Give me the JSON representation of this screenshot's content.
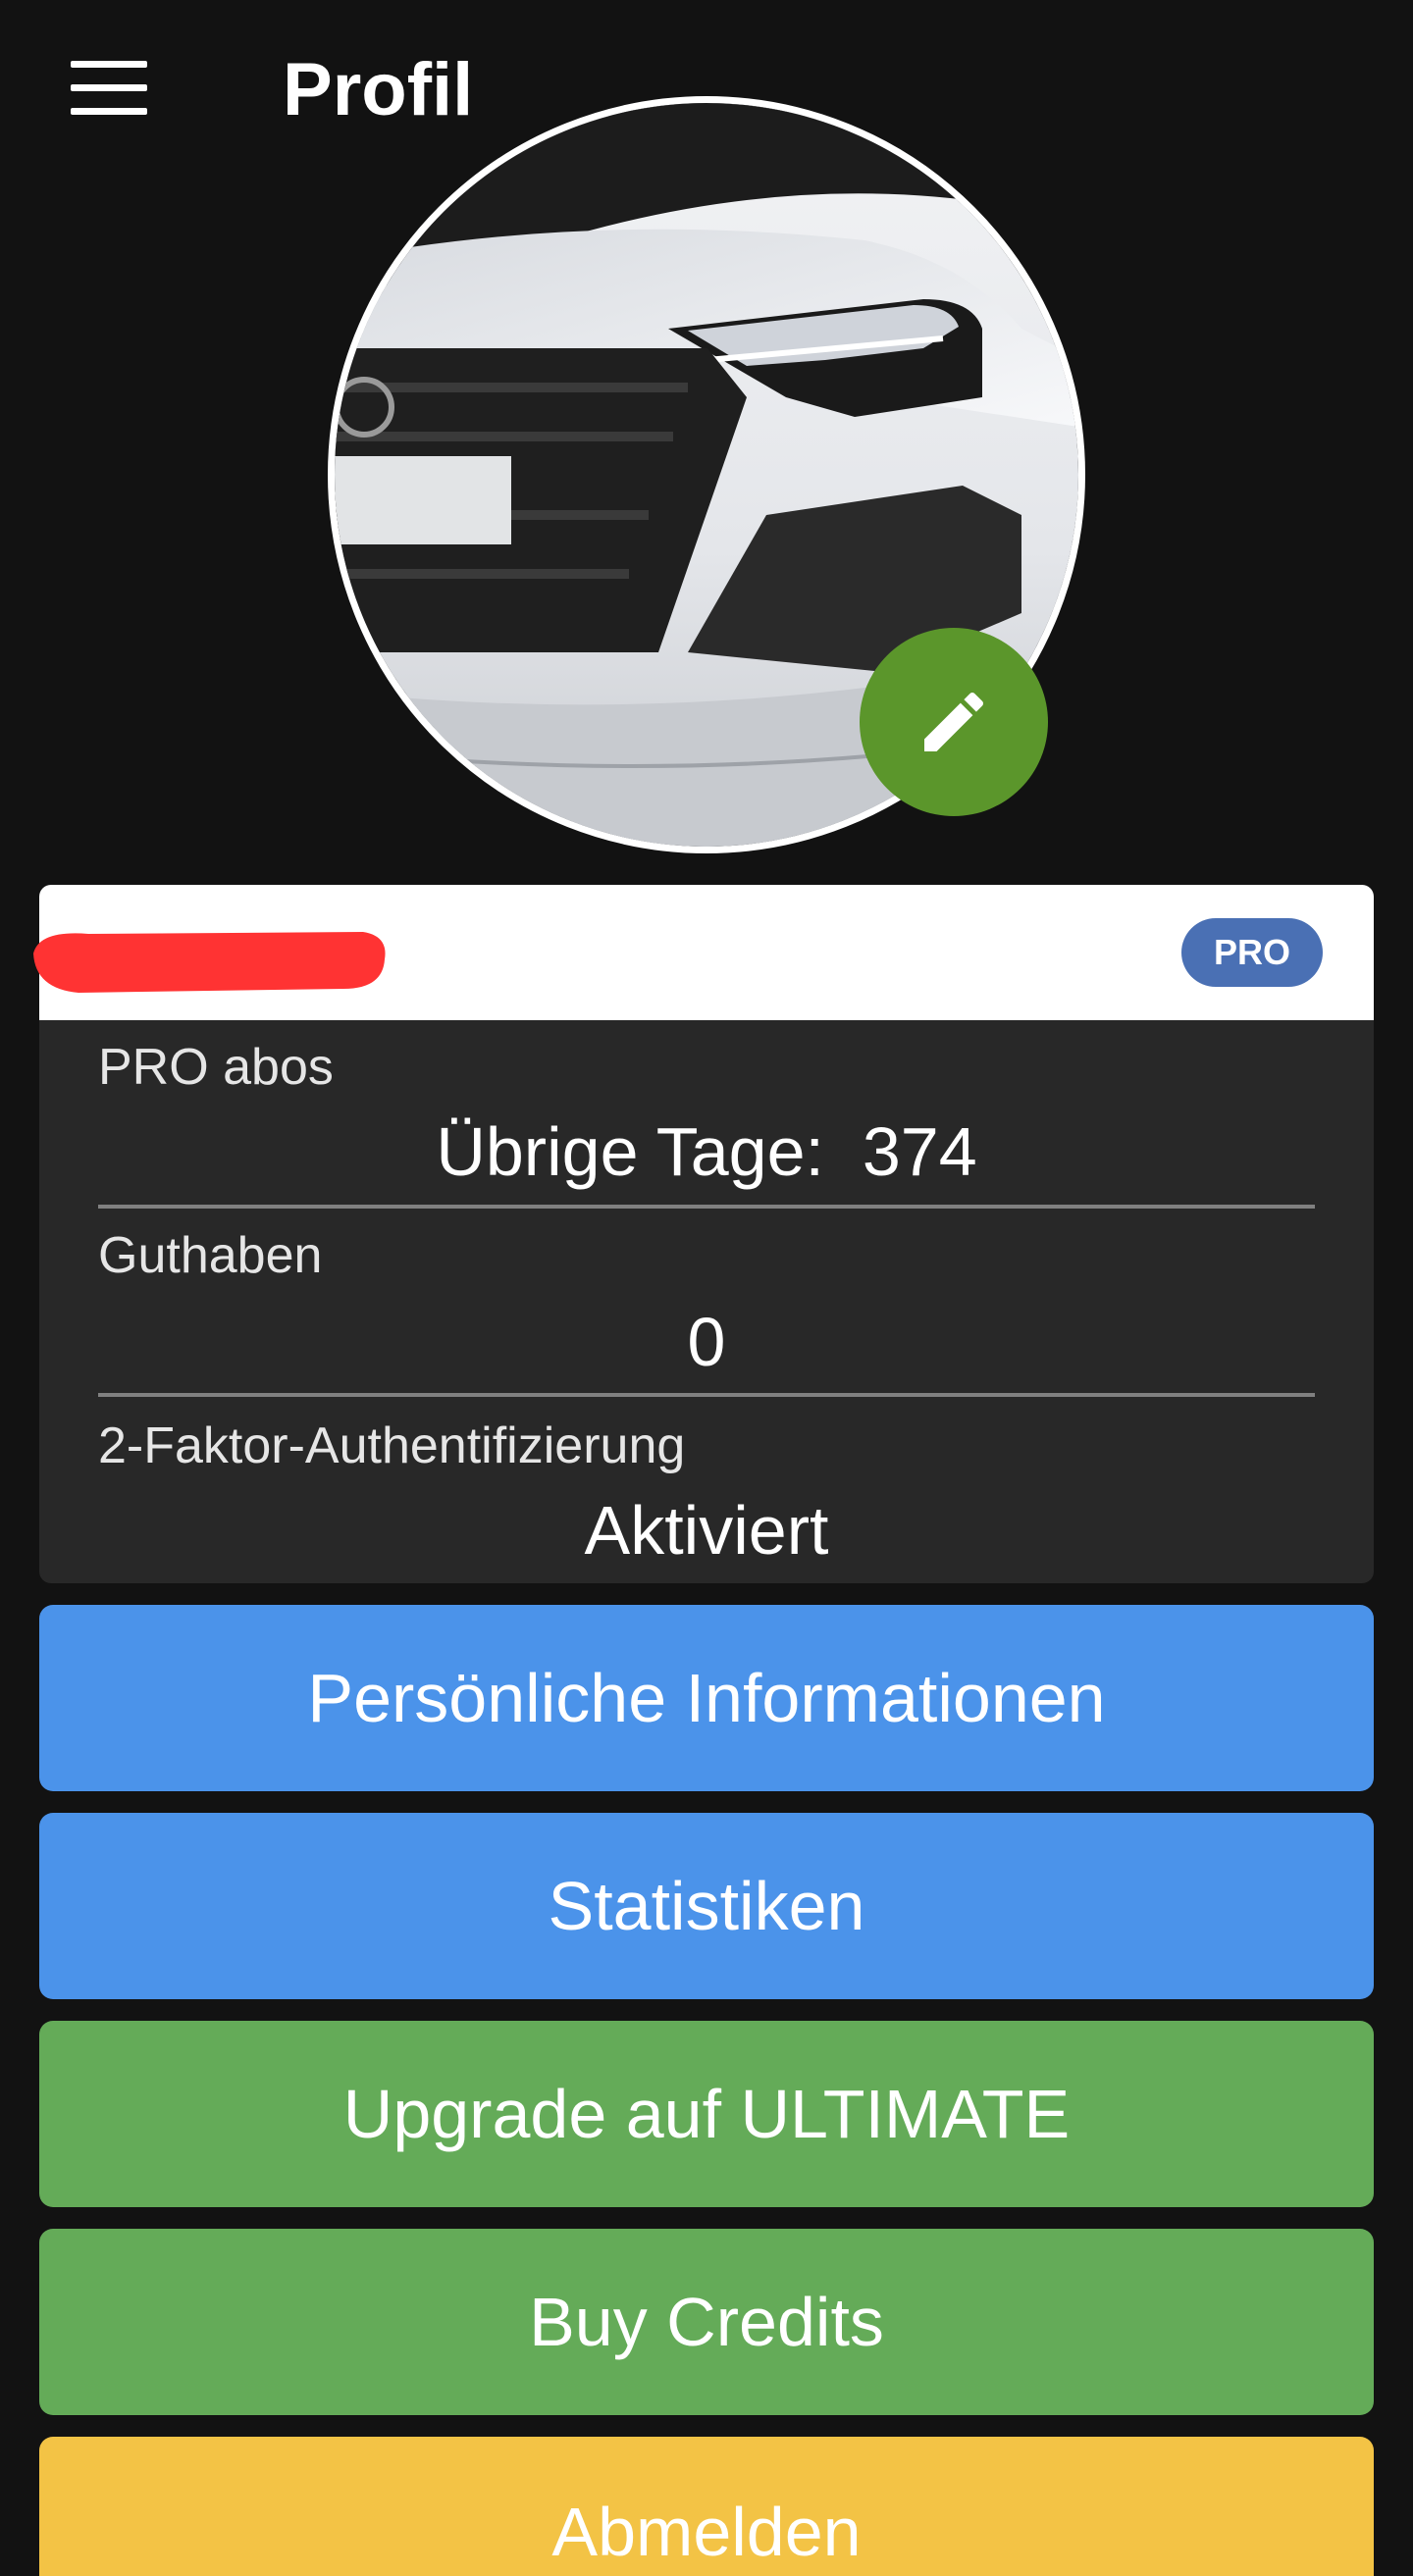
{
  "header": {
    "title": "Profil",
    "menu_icon": "hamburger-menu-icon"
  },
  "profile": {
    "avatar_description": "car-photo",
    "edit_icon": "pencil-icon",
    "badge": "PRO"
  },
  "info": {
    "subscription_label": "PRO abos",
    "subscription_value": "Übrige Tage:  374",
    "credit_label": "Guthaben",
    "credit_value": "0",
    "twofa_label": "2-Faktor-Authentifizierung",
    "twofa_value": "Aktiviert"
  },
  "buttons": {
    "personal_info": "Persönliche Informationen",
    "statistics": "Statistiken",
    "upgrade": "Upgrade auf ULTIMATE",
    "buy_credits": "Buy Credits",
    "logout": "Abmelden"
  },
  "colors": {
    "background": "#121212",
    "card": "#282828",
    "blue_button": "#4b93ea",
    "green_button": "#64ab58",
    "yellow_button": "#f3c345",
    "edit_button": "#5b962b",
    "pro_badge": "#4a70b4",
    "redaction": "#ff3333"
  }
}
